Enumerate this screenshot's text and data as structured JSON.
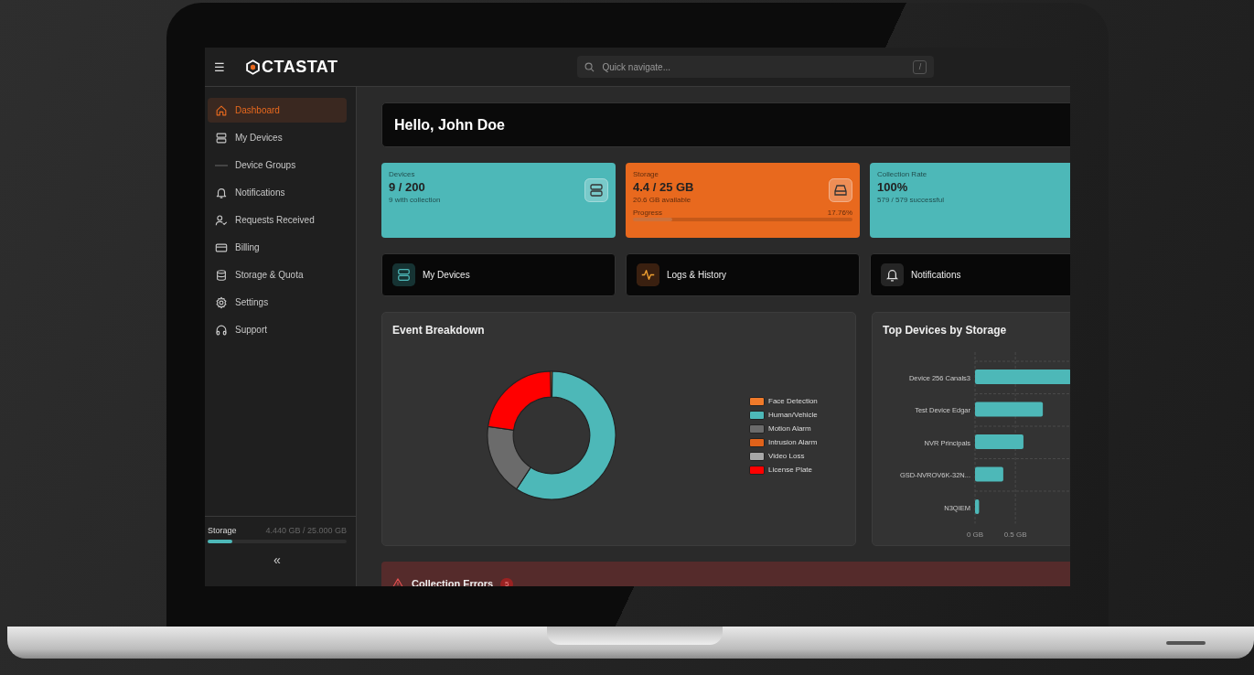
{
  "topbar": {
    "menu": "☰",
    "logo": "CTASTAT",
    "search": {
      "placeholder": "Quick navigate...",
      "shortcut": "/"
    }
  },
  "sidebar": {
    "items": [
      {
        "label": "Dashboard",
        "selected": true
      },
      {
        "label": "My Devices",
        "selected": false
      },
      {
        "label": "Device Groups",
        "selected": false
      },
      {
        "label": "Notifications",
        "selected": false
      },
      {
        "label": "Requests Received",
        "selected": false
      },
      {
        "label": "Billing",
        "selected": false
      },
      {
        "label": "Storage & Quota",
        "selected": false
      },
      {
        "label": "Settings",
        "selected": false
      },
      {
        "label": "Support",
        "selected": false
      }
    ],
    "storage": {
      "label": "Storage",
      "reading": "4.440 GB / 25.000 GB",
      "level": 0.1776
    },
    "collapse": "«"
  },
  "greeting": "Hello, John Doe",
  "stats": [
    {
      "label": "Devices",
      "value": "9 / 200",
      "detail": "9 with collection",
      "color": "#4db8b8"
    },
    {
      "label": "Storage",
      "value": "4.4 / 25 GB",
      "detail": "20.6 GB available",
      "color": "#e8691e",
      "progress": {
        "label": "Progress",
        "reading": "17.76%",
        "level": 0.1776
      }
    },
    {
      "label": "Collection Rate",
      "value": "100%",
      "detail": "579 / 579 successful",
      "color": "#4db8b8"
    }
  ],
  "quick_links": [
    {
      "label": "My Devices"
    },
    {
      "label": "Logs & History"
    },
    {
      "label": "Notifications"
    }
  ],
  "event_breakdown": {
    "title": "Event Breakdown",
    "legend": [
      {
        "label": "Face Detection",
        "color": "#f07a2a"
      },
      {
        "label": "Human/Vehicle",
        "color": "#4db8b8"
      },
      {
        "label": "Motion Alarm",
        "color": "#6b6b6b"
      },
      {
        "label": "Intrusion Alarm",
        "color": "#e0621a"
      },
      {
        "label": "Video Loss",
        "color": "#a6a6a6"
      },
      {
        "label": "License Plate",
        "color": "#ff0000"
      }
    ]
  },
  "top_devices": {
    "title": "Top Devices by Storage",
    "chart_data": {
      "type": "bar",
      "orientation": "horizontal",
      "categories": [
        "Device 256 Canals3",
        "Test Device Edgar",
        "NVR Principals",
        "GSD-NVROV6K-32N...",
        "N3QIEM"
      ],
      "values": [
        1.19,
        0.84,
        0.6,
        0.35,
        0.05
      ],
      "xlim": [
        0,
        1.19
      ],
      "xticks": [
        {
          "value": 0,
          "label": "0 GB"
        },
        {
          "value": 0.5,
          "label": "0.5 GB"
        }
      ]
    }
  },
  "collection_errors": {
    "title": "Collection Errors",
    "count": "5"
  }
}
